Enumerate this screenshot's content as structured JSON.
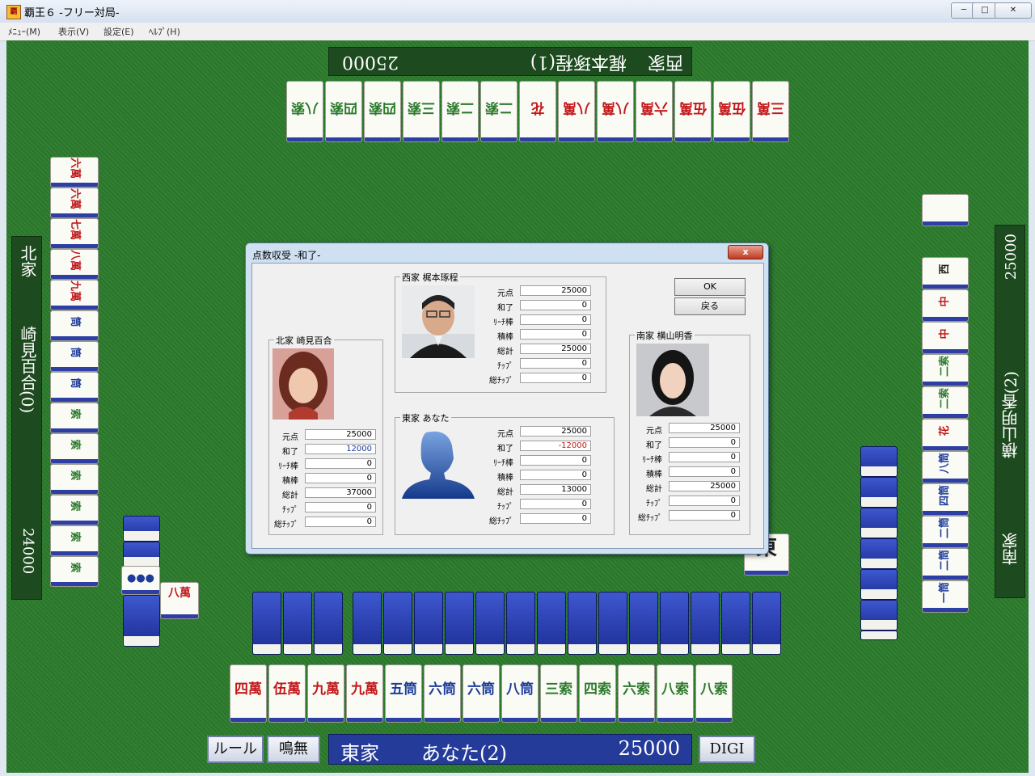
{
  "window": {
    "title": "覇王６ -フリー対局-",
    "icon_text": "覇"
  },
  "menu": [
    "ﾒﾆｭｰ(M)",
    "表示(V)",
    "設定(E)",
    "ﾍﾙﾌﾟ(H)"
  ],
  "players": {
    "west": {
      "seat": "西家",
      "name": "梶本琢程(1)",
      "score": "25000"
    },
    "north": {
      "seat": "北家",
      "name": "崎見百合(0)",
      "score": "24000"
    },
    "south": {
      "seat": "南家",
      "name": "横山明香(2)",
      "score": "25000"
    },
    "east": {
      "seat": "東家",
      "name": "あなた(2)",
      "score": "25000"
    }
  },
  "bottom_buttons": {
    "rule": "ルール",
    "call": "鳴無",
    "digi": "DIGI"
  },
  "tiles": {
    "west_hand": [
      "三萬",
      "伍萬",
      "伍萬",
      "六萬",
      "八萬",
      "八萬",
      "花",
      "二索",
      "二索",
      "三索",
      "四索",
      "四索",
      "八索"
    ],
    "north_hand": [
      "六萬",
      "六萬",
      "七萬",
      "八萬",
      "九萬",
      "筒",
      "筒",
      "筒",
      "索",
      "索",
      "索",
      "索",
      "索",
      "索"
    ],
    "south_hand": [
      "一筒",
      "二筒",
      "二筒",
      "四筒",
      "八筒",
      "花",
      "二索",
      "二索",
      "中",
      "中",
      "西"
    ],
    "east_hand": [
      "四萬",
      "伍萬",
      "九萬",
      "九萬",
      "五筒",
      "六筒",
      "六筒",
      "八筒",
      "三索",
      "四索",
      "六索",
      "八索",
      "八索"
    ],
    "north_discards": [
      "八萬"
    ],
    "center_tile": "東"
  },
  "dialog": {
    "title": "点数収受 -和了-",
    "close_label": "x",
    "ok_label": "OK",
    "back_label": "戻る",
    "row_labels": [
      "元点",
      "和了",
      "ﾘｰﾁ棒",
      "積棒",
      "総計",
      "ﾁｯﾌﾟ",
      "総ﾁｯﾌﾟ"
    ],
    "west": {
      "label": "西家 梶本琢程",
      "values": [
        "25000",
        "0",
        "0",
        "0",
        "25000",
        "0",
        "0"
      ]
    },
    "north": {
      "label": "北家 崎見百合",
      "values": [
        "25000",
        "12000",
        "0",
        "0",
        "37000",
        "0",
        "0"
      ]
    },
    "east": {
      "label": "東家 あなた",
      "values": [
        "25000",
        "-12000",
        "0",
        "0",
        "13000",
        "0",
        "0"
      ]
    },
    "south": {
      "label": "南家 横山明香",
      "values": [
        "25000",
        "0",
        "0",
        "0",
        "25000",
        "0",
        "0"
      ]
    }
  }
}
